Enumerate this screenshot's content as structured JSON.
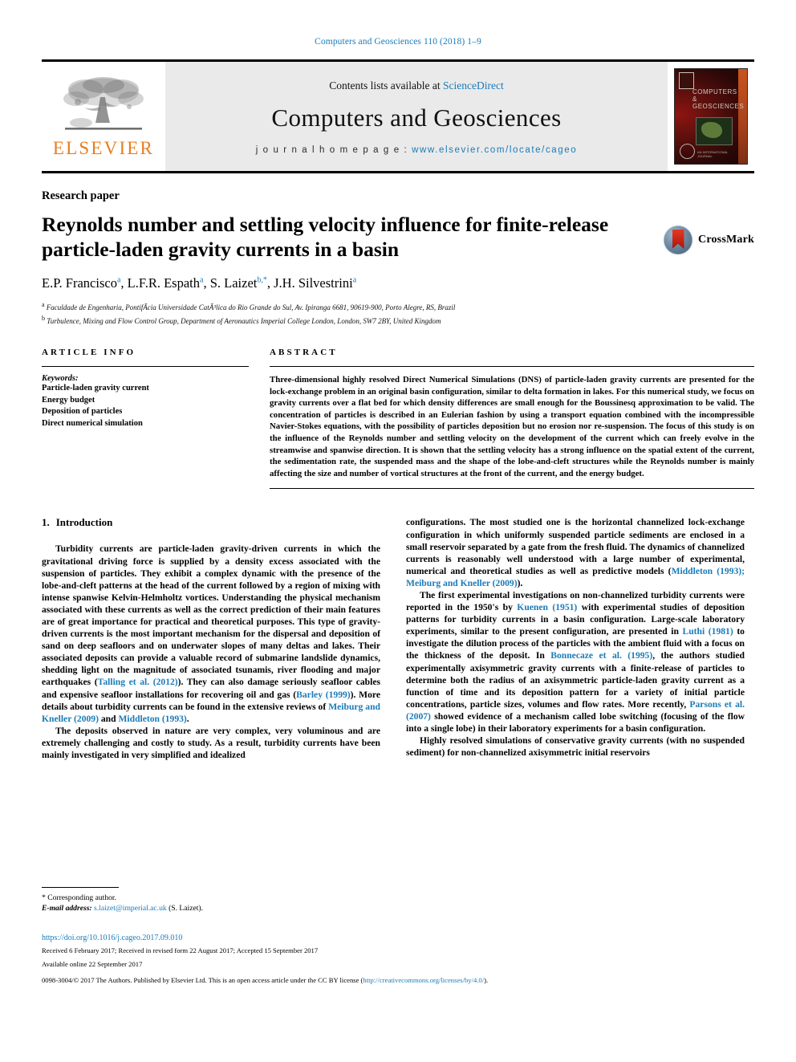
{
  "running_head": "Computers and Geosciences 110 (2018) 1–9",
  "masthead": {
    "contents_prefix": "Contents lists available at ",
    "contents_link": "ScienceDirect",
    "journal_title": "Computers and Geosciences",
    "homepage_prefix": "j o u r n a l   h o m e p a g e :   ",
    "homepage_url": "www.elsevier.com/locate/cageo",
    "publisher_logo_text": "ELSEVIER",
    "cover_title": "COMPUTERS & GEOSCIENCES",
    "cover_subtitle": "AN INTERNATIONAL JOURNAL"
  },
  "article": {
    "kind": "Research paper",
    "title": "Reynolds number and settling velocity influence for finite-release particle-laden gravity currents in a basin",
    "crossmark_label": "CrossMark",
    "authors": [
      {
        "name": "E.P. Francisco",
        "marks": "a"
      },
      {
        "name": "L.F.R. Espath",
        "marks": "a"
      },
      {
        "name": "S. Laizet",
        "marks": "b,*"
      },
      {
        "name": "J.H. Silvestrini",
        "marks": "a"
      }
    ],
    "affiliations": [
      {
        "mark": "a",
        "text": "Faculdade de Engenharia, PontifÃ­cia Universidade CatÃ³lica do Rio Grande do Sul, Av. Ipiranga 6681, 90619-900, Porto Alegre, RS, Brazil"
      },
      {
        "mark": "b",
        "text": "Turbulence, Mixing and Flow Control Group, Department of Aeronautics Imperial College London, London, SW7 2BY, United Kingdom"
      }
    ]
  },
  "article_info": {
    "heading": "ARTICLE INFO",
    "keywords_label": "Keywords:",
    "keywords": [
      "Particle-laden gravity current",
      "Energy budget",
      "Deposition of particles",
      "Direct numerical simulation"
    ]
  },
  "abstract": {
    "heading": "ABSTRACT",
    "text": "Three-dimensional highly resolved Direct Numerical Simulations (DNS) of particle-laden gravity currents are presented for the lock-exchange problem in an original basin configuration, similar to delta formation in lakes. For this numerical study, we focus on gravity currents over a flat bed for which density differences are small enough for the Boussinesq approximation to be valid. The concentration of particles is described in an Eulerian fashion by using a transport equation combined with the incompressible Navier-Stokes equations, with the possibility of particles deposition but no erosion nor re-suspension. The focus of this study is on the influence of the Reynolds number and settling velocity on the development of the current which can freely evolve in the streamwise and spanwise direction. It is shown that the settling velocity has a strong influence on the spatial extent of the current, the sedimentation rate, the suspended mass and the shape of the lobe-and-cleft structures while the Reynolds number is mainly affecting the size and number of vortical structures at the front of the current, and the energy budget."
  },
  "section": {
    "number": "1.",
    "heading": "Introduction"
  },
  "body": {
    "left_paragraphs": [
      {
        "indent": true,
        "runs": [
          {
            "t": "Turbidity currents are particle-laden gravity-driven currents in which the gravitational driving force is supplied by a density excess associated with the suspension of particles. They exhibit a complex dynamic with the presence of the lobe-and-cleft patterns at the head of the current followed by a region of mixing with intense spanwise Kelvin-Helmholtz vortices. Understanding the physical mechanism associated with these currents as well as the correct prediction of their main features are of great importance for practical and theoretical purposes. This type of gravity-driven currents is the most important mechanism for the dispersal and deposition of sand on deep seafloors and on underwater slopes of many deltas and lakes. Their associated deposits can provide a valuable record of submarine landslide dynamics, shedding light on the magnitude of associated tsunamis, river flooding and major earthquakes (",
            "link": false
          },
          {
            "t": "Talling et al. (2012)",
            "link": true
          },
          {
            "t": "). They can also damage seriously seafloor cables and expensive seafloor installations for recovering oil and gas (",
            "link": false
          },
          {
            "t": "Barley (1999)",
            "link": true
          },
          {
            "t": "). More details about turbidity currents can be found in the extensive reviews of ",
            "link": false
          },
          {
            "t": "Meiburg and Kneller (2009)",
            "link": true
          },
          {
            "t": " and ",
            "link": false
          },
          {
            "t": "Middleton (1993)",
            "link": true
          },
          {
            "t": ".",
            "link": false
          }
        ]
      },
      {
        "indent": true,
        "runs": [
          {
            "t": "The deposits observed in nature are very complex, very voluminous and are extremely challenging and costly to study. As a result, turbidity currents have been mainly investigated in very simplified and idealized",
            "link": false
          }
        ]
      }
    ],
    "right_paragraphs": [
      {
        "indent": false,
        "runs": [
          {
            "t": "configurations. The most studied one is the horizontal channelized lock-exchange configuration in which uniformly suspended particle sediments are enclosed in a small reservoir separated by a gate from the fresh fluid. The dynamics of channelized currents is reasonably well understood with a large number of experimental, numerical and theoretical studies as well as predictive models (",
            "link": false
          },
          {
            "t": "Middleton (1993); Meiburg and Kneller (2009)",
            "link": true
          },
          {
            "t": ").",
            "link": false
          }
        ]
      },
      {
        "indent": true,
        "runs": [
          {
            "t": "The first experimental investigations on non-channelized turbidity currents were reported in the 1950's by ",
            "link": false
          },
          {
            "t": "Kuenen (1951)",
            "link": true
          },
          {
            "t": " with experimental studies of deposition patterns for turbidity currents in a basin configuration. Large-scale laboratory experiments, similar to the present configuration, are presented in ",
            "link": false
          },
          {
            "t": "Luthi (1981)",
            "link": true
          },
          {
            "t": " to investigate the dilution process of the particles with the ambient fluid with a focus on the thickness of the deposit. In ",
            "link": false
          },
          {
            "t": "Bonnecaze et al. (1995)",
            "link": true
          },
          {
            "t": ", the authors studied experimentally axisymmetric gravity currents with a finite-release of particles to determine both the radius of an axisymmetric particle-laden gravity current as a function of time and its deposition pattern for a variety of initial particle concentrations, particle sizes, volumes and flow rates. More recently, ",
            "link": false
          },
          {
            "t": "Parsons et al. (2007)",
            "link": true
          },
          {
            "t": " showed evidence of a mechanism called lobe switching (focusing of the flow into a single lobe) in their laboratory experiments for a basin configuration.",
            "link": false
          }
        ]
      },
      {
        "indent": true,
        "runs": [
          {
            "t": "Highly resolved simulations of conservative gravity currents (with no suspended sediment) for non-channelized axisymmetric initial reservoirs",
            "link": false
          }
        ]
      }
    ]
  },
  "footnote": {
    "corresponding": "* Corresponding author.",
    "email_label": "E-mail address:",
    "email": "s.laizet@imperial.ac.uk",
    "email_owner": "(S. Laizet)."
  },
  "footer": {
    "doi": "https://doi.org/10.1016/j.cageo.2017.09.010",
    "history_received": "Received 6 February 2017; Received in revised form 22 August 2017; Accepted 15 September 2017",
    "history_online": "Available online 22 September 2017",
    "copyright_pre": "0098-3004/© 2017 The Authors. Published by Elsevier Ltd. This is an open access article under the CC BY license (",
    "copyright_link": "http://creativecommons.org/licenses/by/4.0/",
    "copyright_post": ")."
  },
  "colors": {
    "link": "#1a7bb9",
    "elsevier_orange": "#e87d1e"
  }
}
